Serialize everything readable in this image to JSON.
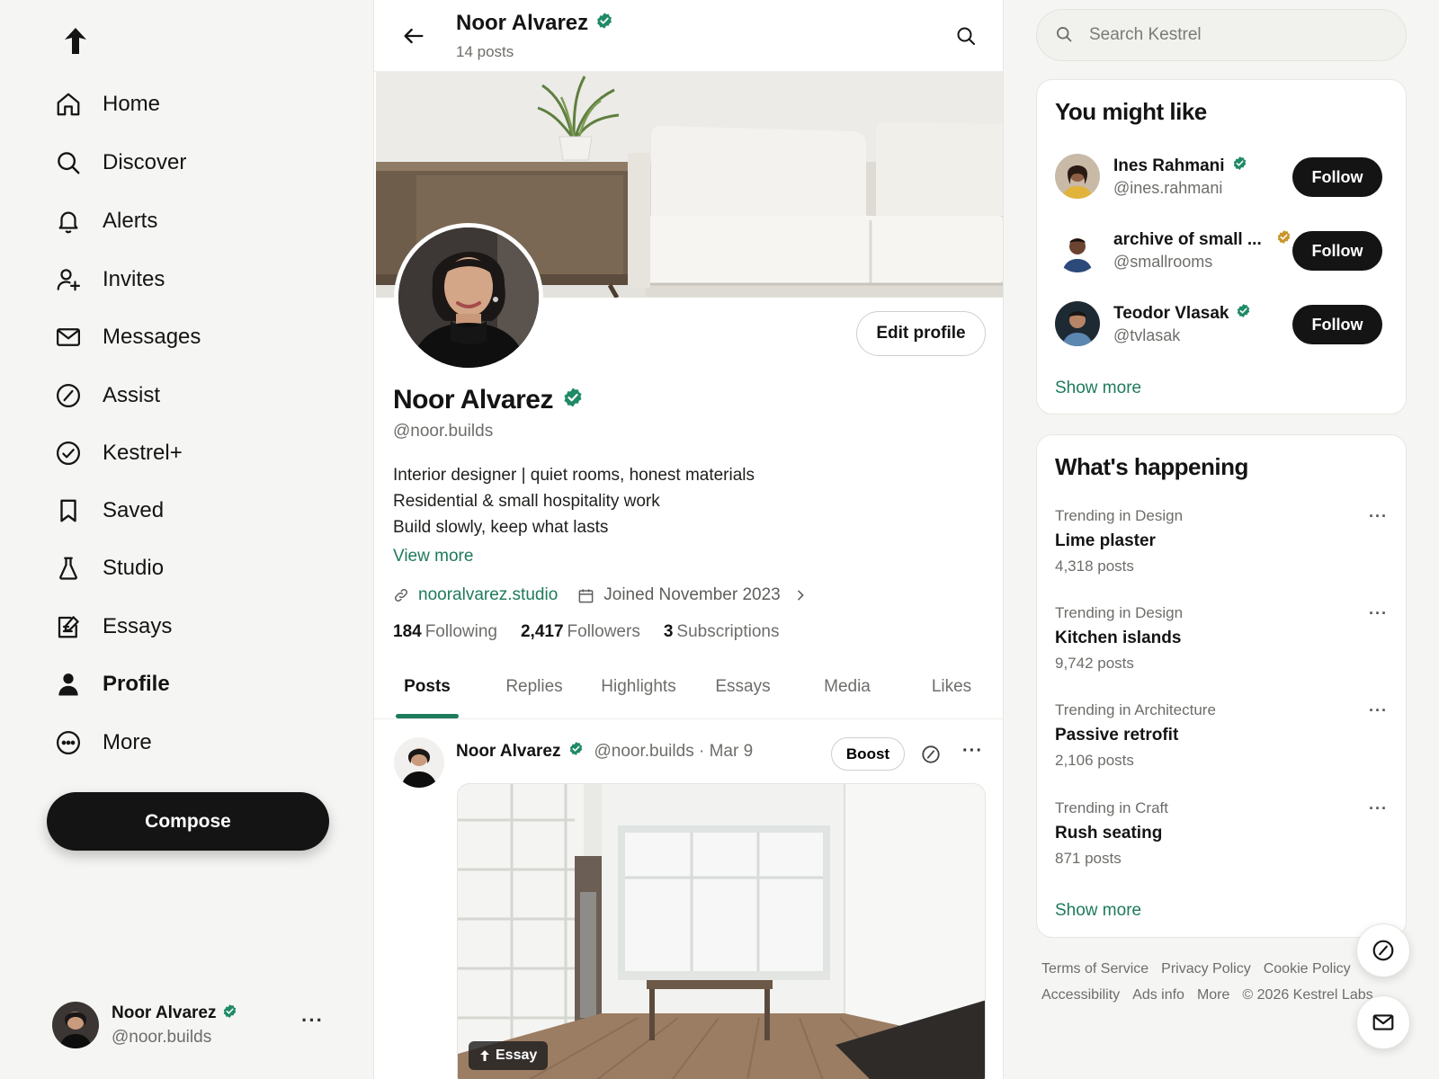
{
  "nav": {
    "items": [
      {
        "label": "Home",
        "icon": "home-icon"
      },
      {
        "label": "Discover",
        "icon": "search-icon"
      },
      {
        "label": "Alerts",
        "icon": "bell-icon"
      },
      {
        "label": "Invites",
        "icon": "user-plus-icon"
      },
      {
        "label": "Messages",
        "icon": "mail-icon"
      },
      {
        "label": "Assist",
        "icon": "slash-circle-icon"
      },
      {
        "label": "Kestrel+",
        "icon": "check-circle-icon"
      },
      {
        "label": "Saved",
        "icon": "bookmark-icon"
      },
      {
        "label": "Studio",
        "icon": "flask-icon"
      },
      {
        "label": "Essays",
        "icon": "note-edit-icon"
      },
      {
        "label": "Profile",
        "icon": "person-icon",
        "active": true
      },
      {
        "label": "More",
        "icon": "more-circle-icon"
      }
    ],
    "compose_label": "Compose",
    "account": {
      "name": "Noor Alvarez",
      "handle": "@noor.builds",
      "more": "···"
    }
  },
  "header": {
    "title": "Noor Alvarez",
    "post_count": "14 posts"
  },
  "profile": {
    "name": "Noor Alvarez",
    "handle": "@noor.builds",
    "edit_label": "Edit profile",
    "bio": [
      "Interior designer | quiet rooms, honest materials",
      "Residential & small hospitality work",
      "Build slowly, keep what lasts"
    ],
    "view_more": "View more",
    "website": "nooralvarez.studio",
    "joined": "Joined November 2023",
    "stats": {
      "following_count": "184",
      "following_label": "Following",
      "followers_count": "2,417",
      "followers_label": "Followers",
      "subs_count": "3",
      "subs_label": "Subscriptions"
    },
    "tabs": [
      "Posts",
      "Replies",
      "Highlights",
      "Essays",
      "Media",
      "Likes"
    ],
    "active_tab": "Posts"
  },
  "post": {
    "author": "Noor Alvarez",
    "handle_date": "@noor.builds · Mar 9",
    "boost_label": "Boost",
    "more": "···",
    "badge": "Essay"
  },
  "search": {
    "placeholder": "Search Kestrel"
  },
  "suggestions": {
    "title": "You might like",
    "items": [
      {
        "name": "Ines Rahmani",
        "handle": "@ines.rahmani",
        "verified": "green",
        "button": "Follow"
      },
      {
        "name": "archive of small ...",
        "handle": "@smallrooms",
        "verified": "gold",
        "button": "Follow"
      },
      {
        "name": "Teodor Vlasak",
        "handle": "@tvlasak",
        "verified": "green",
        "button": "Follow"
      }
    ],
    "show_more": "Show more"
  },
  "trends": {
    "title": "What's happening",
    "items": [
      {
        "context": "Trending in Design",
        "title": "Lime plaster",
        "count": "4,318 posts"
      },
      {
        "context": "Trending in Design",
        "title": "Kitchen islands",
        "count": "9,742 posts"
      },
      {
        "context": "Trending in Architecture",
        "title": "Passive retrofit",
        "count": "2,106 posts"
      },
      {
        "context": "Trending in Craft",
        "title": "Rush seating",
        "count": "871 posts"
      }
    ],
    "more": "···",
    "show_more": "Show more"
  },
  "footer": {
    "links": [
      "Terms of Service",
      "Privacy Policy",
      "Cookie Policy",
      "Accessibility",
      "Ads info",
      "More",
      "© 2026 Kestrel Labs"
    ]
  },
  "colors": {
    "accent": "#1f7a5c",
    "verified_green": "#1f8a66",
    "verified_gold": "#c9962b",
    "ink": "#141414",
    "muted": "#6d6d6a"
  }
}
